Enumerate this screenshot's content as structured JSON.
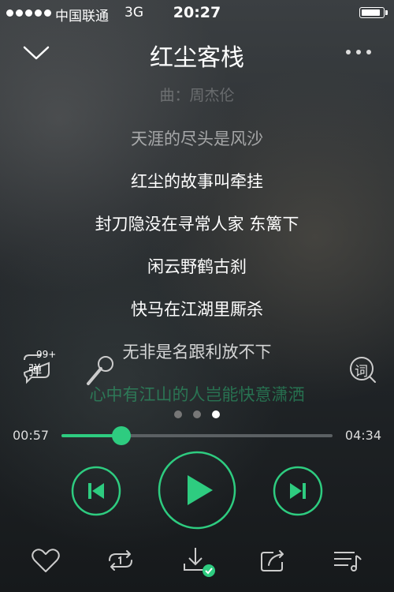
{
  "status": {
    "carrier": "中国联通",
    "network": "3G",
    "time": "20:27"
  },
  "song": {
    "title": "红尘客栈"
  },
  "lyrics": [
    {
      "text": "曲：周杰伦",
      "state": "faded"
    },
    {
      "text": "天涯的尽头是风沙",
      "state": "past"
    },
    {
      "text": "红尘的故事叫牵挂",
      "state": "normal"
    },
    {
      "text": "封刀隐没在寻常人家 东篱下",
      "state": "normal"
    },
    {
      "text": "闲云野鹤古刹",
      "state": "normal"
    },
    {
      "text": "快马在江湖里厮杀",
      "state": "normal"
    },
    {
      "text": "无非是名跟利放不下",
      "state": "upcoming"
    },
    {
      "text": "心中有江山的人岂能快意潇洒",
      "state": "current"
    }
  ],
  "danmu": {
    "label": "弹",
    "count": "99+"
  },
  "lyric_button": {
    "label": "词"
  },
  "pages": {
    "total": 3,
    "active": 3
  },
  "progress": {
    "current": "00:57",
    "total": "04:34",
    "fraction": 0.22
  },
  "colors": {
    "accent": "#2ecc80",
    "text": "#ffffff"
  },
  "icons": [
    "chevron-down-icon",
    "more-icon",
    "danmu-icon",
    "microphone-icon",
    "lyric-icon",
    "previous-icon",
    "play-icon",
    "next-icon",
    "heart-icon",
    "repeat-one-icon",
    "download-icon",
    "share-icon",
    "playlist-icon"
  ]
}
